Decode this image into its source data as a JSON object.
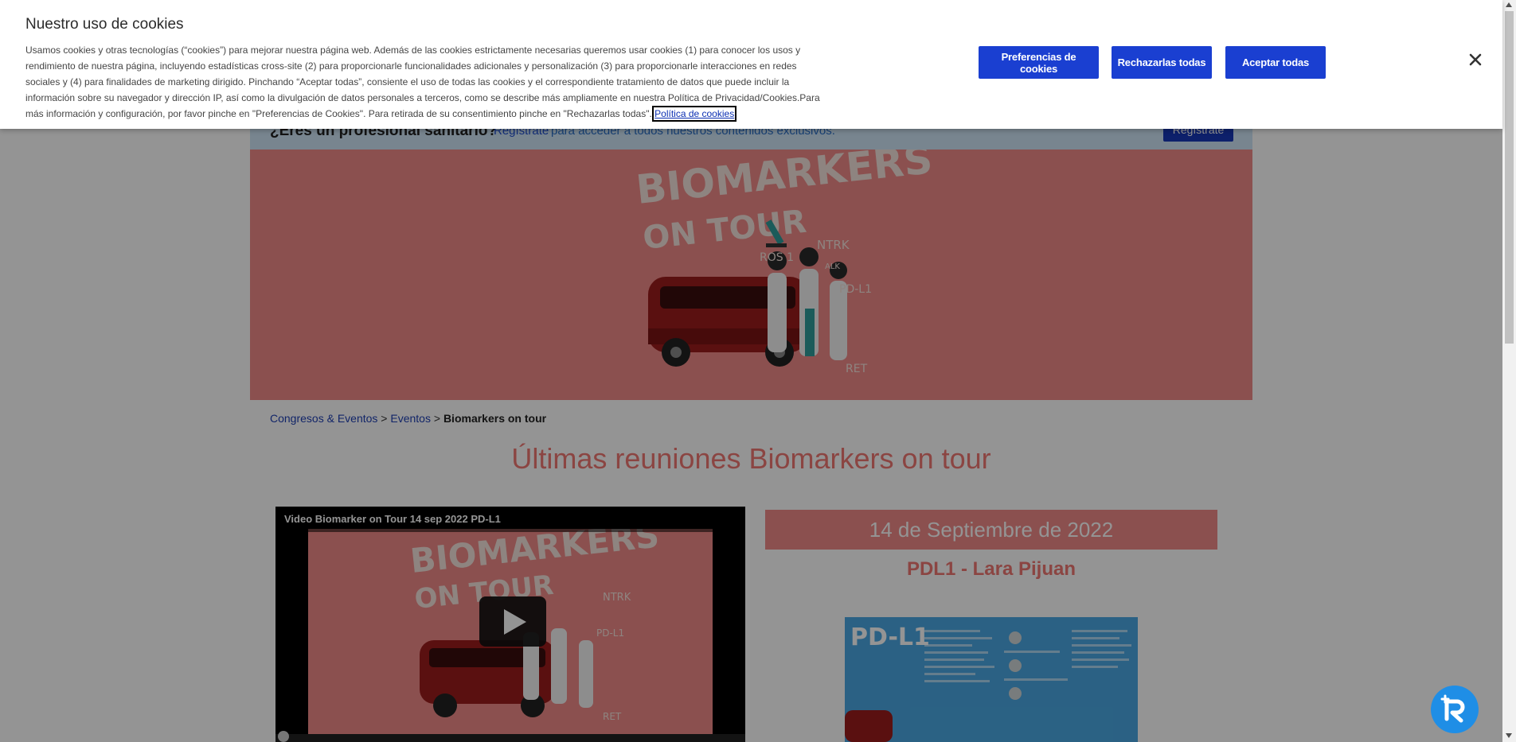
{
  "cookie_banner": {
    "title": "Nuestro uso de cookies",
    "body": "Usamos cookies y otras tecnologías (“cookies”) para mejorar nuestra página web. Además de las cookies estrictamente necesarias queremos usar cookies (1) para conocer los usos y rendimiento de nuestra página, incluyendo estadísticas cross-site (2) para proporcionarle funcionalidades adicionales y personalización (3) para proporcionarle interacciones en redes sociales y (4) para finalidades de marketing dirigido. Pinchando “Aceptar todas”, consiente el uso de todas las cookies y el correspondiente tratamiento de datos que puede incluir la información sobre su navegador y dirección IP, así como la divulgación de datos personales a terceros, como se describe más ampliamente en nuestra Política de Privacidad/Cookies.Para más información y configuración, por favor pinche en \"Preferencias de Cookies\". Para retirada de su consentimiento pinche en \"Rechazarlas todas\".",
    "policy_link": "Política de cookies",
    "btn_prefs": "Preferencias de cookies",
    "btn_reject": "Rechazarlas todas",
    "btn_accept": "Aceptar todas",
    "close_icon": "close-icon"
  },
  "pro_bar": {
    "question": "¿Eres un profesional sanitario?",
    "register_link": "Regístrate",
    "rest": "para acceder a todos nuestros contenidos exclusivos.",
    "register_button": "Regístrate"
  },
  "hero": {
    "logo_line1": "BIOMARKERS",
    "logo_line2": "ON TOUR",
    "tags": [
      "ROS 1",
      "NTRK",
      "ALK",
      "PD-L1",
      "RET"
    ]
  },
  "breadcrumb": {
    "items": [
      "Congresos & Eventos",
      "Eventos"
    ],
    "separator": ">",
    "current": "Biomarkers on tour"
  },
  "main": {
    "title": "Últimas reuniones Biomarkers on tour",
    "video_title": "Video Biomarker on Tour 14 sep 2022 PD-L1",
    "date": "14 de Septiembre de 2022",
    "speaker": "PDL1 - Lara Pijuan",
    "poster_title": "PD-L1"
  },
  "colors": {
    "accent": "#f08a88",
    "title_color": "#f07773",
    "button_blue": "#1a3fd1"
  }
}
